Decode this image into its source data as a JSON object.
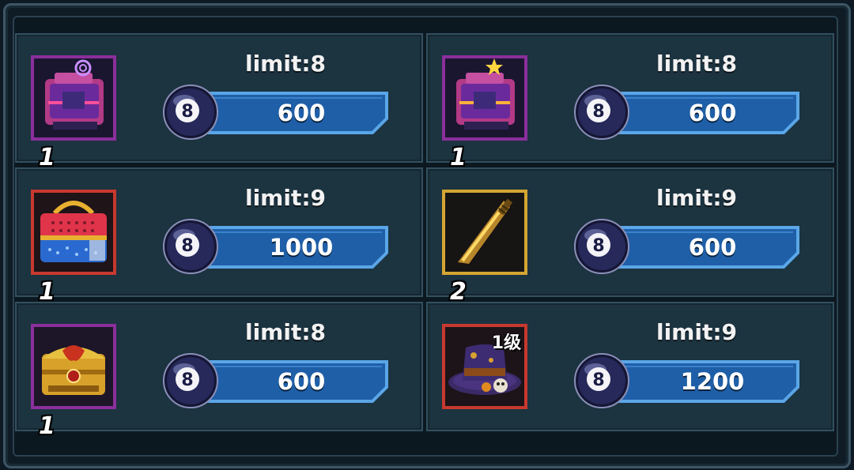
{
  "shop": {
    "items": [
      {
        "name": "purple-mech-chest",
        "qty": "1",
        "limit": "limit:8",
        "price": "600",
        "rarity": "purple"
      },
      {
        "name": "purple-mech-chest-star",
        "qty": "1",
        "limit": "limit:8",
        "price": "600",
        "rarity": "purple"
      },
      {
        "name": "pet-carrier",
        "qty": "1",
        "limit": "limit:9",
        "price": "1000",
        "rarity": "red"
      },
      {
        "name": "golden-bat",
        "qty": "2",
        "limit": "limit:9",
        "price": "600",
        "rarity": "gold"
      },
      {
        "name": "gold-dragon-chest",
        "qty": "1",
        "limit": "limit:8",
        "price": "600",
        "rarity": "purple"
      },
      {
        "name": "pumpkin-top-hat",
        "qty": "",
        "level": "1级",
        "limit": "limit:9",
        "price": "1200",
        "rarity": "red"
      }
    ],
    "currency_icon": "eight-ball-icon",
    "colors": {
      "purple": "#8a2f9c",
      "red": "#c7392f",
      "gold": "#d4a531",
      "bar": "#1f5fa8",
      "bar_outline": "#5aa6e8"
    }
  }
}
